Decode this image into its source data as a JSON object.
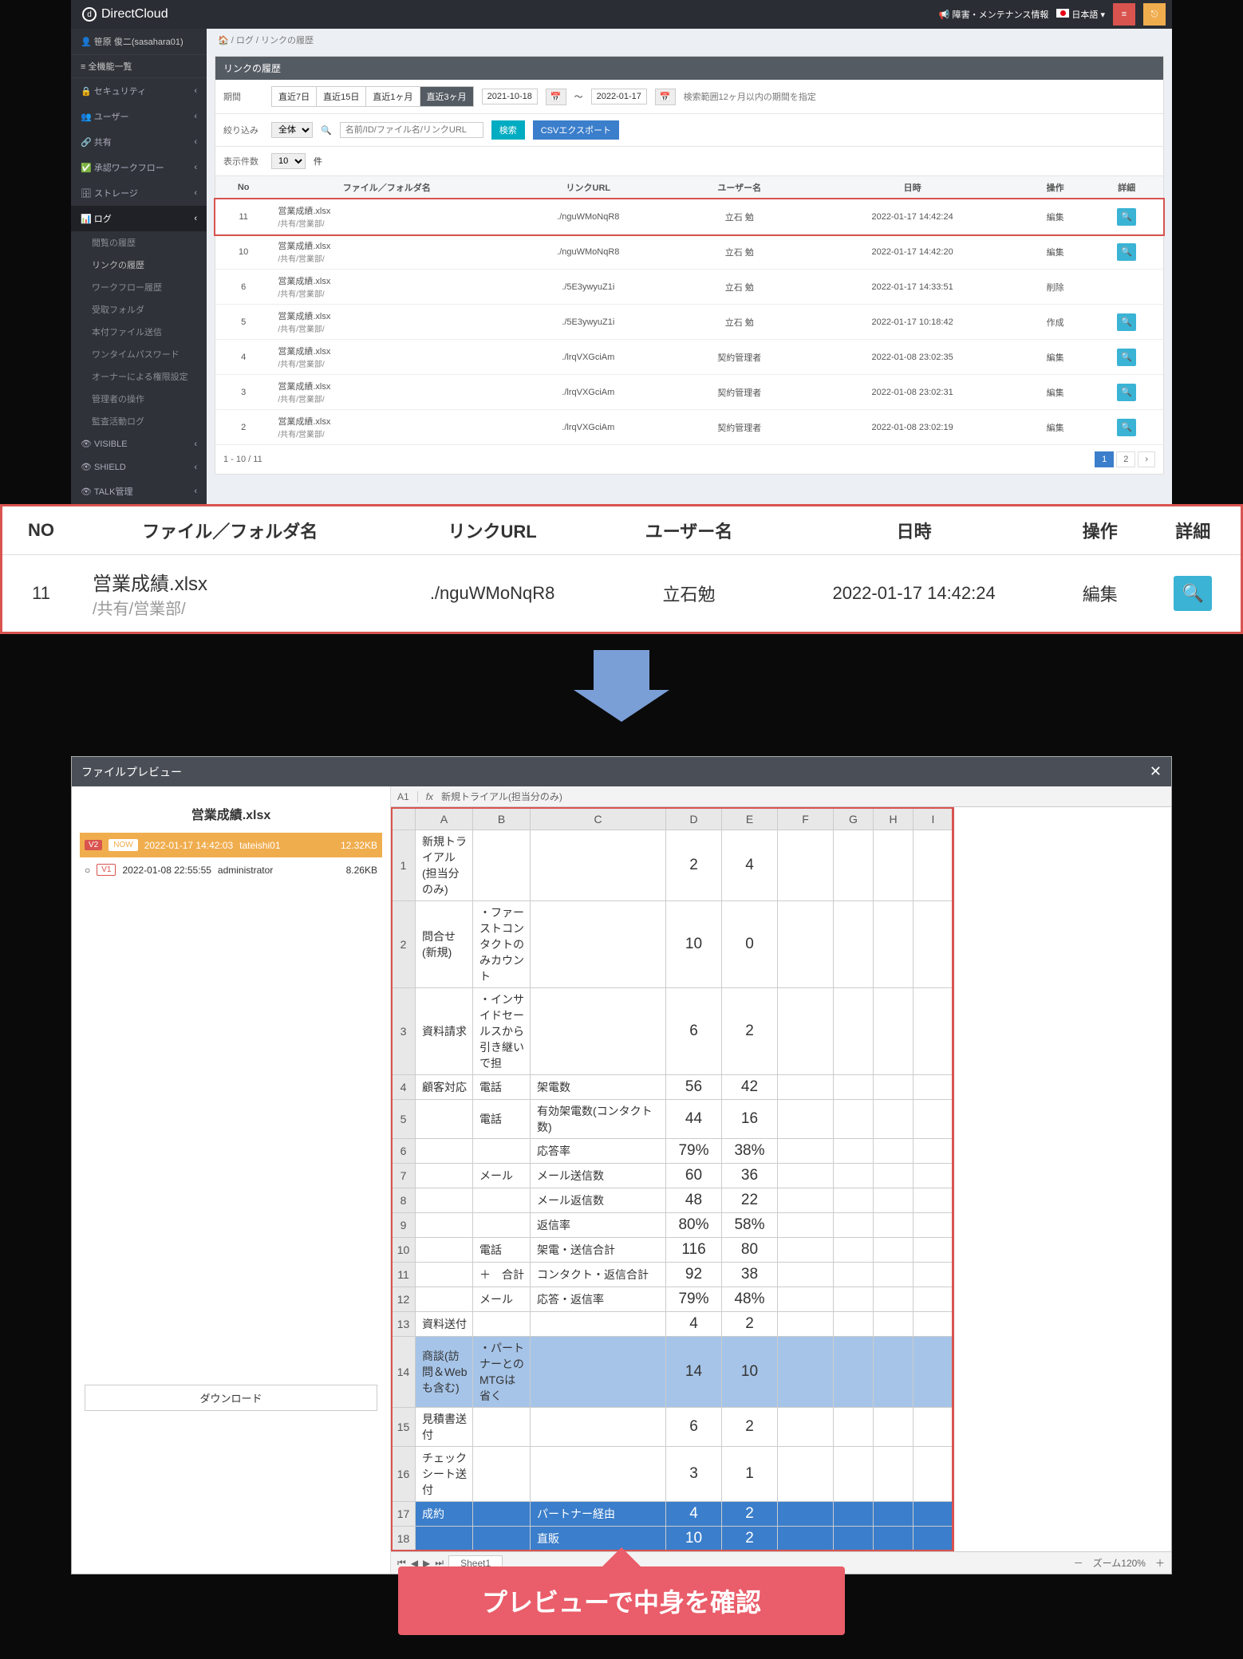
{
  "header": {
    "brand": "DirectCloud",
    "notice": "障害・メンテナンス情報",
    "lang": "日本語"
  },
  "sidebar": {
    "user": "笹原 俊二(sasahara01)",
    "menu_all": "全機能一覧",
    "items": [
      "セキュリティ",
      "ユーザー",
      "共有",
      "承認ワークフロー",
      "ストレージ",
      "ログ"
    ],
    "log_subs": [
      "閲覧の履歴",
      "リンクの履歴",
      "ワークフロー履歴",
      "受取フォルダ",
      "本付ファイル送信",
      "ワンタイムパスワード",
      "オーナーによる権限設定",
      "管理者の操作",
      "監査活動ログ"
    ],
    "extra": [
      "VISIBLE",
      "SHIELD",
      "TALK管理"
    ]
  },
  "crumb": {
    "home": "ログ",
    "leaf": "リンクの履歴"
  },
  "panel_title": "リンクの履歴",
  "filter": {
    "lbl_period": "期間",
    "segs": [
      "直近7日",
      "直近15日",
      "直近1ヶ月",
      "直近3ヶ月"
    ],
    "date_from": "2021-10-18",
    "date_to": "2022-01-17",
    "note": "検索範囲12ヶ月以内の期間を指定",
    "lbl_narrow": "絞り込み",
    "sel": "全体",
    "placeholder": "名前/ID/ファイル名/リンクURL",
    "btn_search": "検索",
    "btn_csv": "CSVエクスポート",
    "lbl_count": "表示件数",
    "count": "10",
    "count_suffix": "件"
  },
  "table": {
    "cols": [
      "No",
      "ファイル／フォルダ名",
      "リンクURL",
      "ユーザー名",
      "日時",
      "操作",
      "詳細"
    ],
    "rows": [
      {
        "no": "11",
        "name": "営業成績.xlsx",
        "path": "/共有/営業部/",
        "url": "./nguWMoNqR8",
        "user": "立石 勉",
        "time": "2022-01-17 14:42:24",
        "op": "編集",
        "mag": true,
        "hl": true
      },
      {
        "no": "10",
        "name": "営業成績.xlsx",
        "path": "/共有/営業部/",
        "url": "./nguWMoNqR8",
        "user": "立石 勉",
        "time": "2022-01-17 14:42:20",
        "op": "編集",
        "mag": true
      },
      {
        "no": "6",
        "name": "営業成績.xlsx",
        "path": "/共有/営業部/",
        "url": "./5E3ywyuZ1i",
        "user": "立石 勉",
        "time": "2022-01-17 14:33:51",
        "op": "削除",
        "mag": false
      },
      {
        "no": "5",
        "name": "営業成績.xlsx",
        "path": "/共有/営業部/",
        "url": "./5E3ywyuZ1i",
        "user": "立石 勉",
        "time": "2022-01-17 10:18:42",
        "op": "作成",
        "mag": true
      },
      {
        "no": "4",
        "name": "営業成績.xlsx",
        "path": "/共有/営業部/",
        "url": "./lrqVXGciAm",
        "user": "契約管理者",
        "time": "2022-01-08 23:02:35",
        "op": "編集",
        "mag": true
      },
      {
        "no": "3",
        "name": "営業成績.xlsx",
        "path": "/共有/営業部/",
        "url": "./lrqVXGciAm",
        "user": "契約管理者",
        "time": "2022-01-08 23:02:31",
        "op": "編集",
        "mag": true
      },
      {
        "no": "2",
        "name": "営業成績.xlsx",
        "path": "/共有/営業部/",
        "url": "./lrqVXGciAm",
        "user": "契約管理者",
        "time": "2022-01-08 23:02:19",
        "op": "編集",
        "mag": true
      }
    ],
    "pager_info": "1 - 10 / 11",
    "pages": [
      "1",
      "2",
      "›"
    ]
  },
  "big": {
    "cols": [
      "NO",
      "ファイル／フォルダ名",
      "リンクURL",
      "ユーザー名",
      "日時",
      "操作",
      "詳細"
    ],
    "no": "11",
    "name": "営業成績.xlsx",
    "path": "/共有/営業部/",
    "url": "./nguWMoNqR8",
    "user": "立石勉",
    "time": "2022-01-17 14:42:24",
    "op": "編集"
  },
  "preview": {
    "title": "ファイルプレビュー",
    "file": "営業成績.xlsx",
    "versions": [
      {
        "v": "V2",
        "now": "NOW",
        "time": "2022-01-17 14:42:03",
        "user": "tateishi01",
        "size": "12.32KB",
        "active": true
      },
      {
        "v": "V1",
        "now": "",
        "time": "2022-01-08 22:55:55",
        "user": "administrator",
        "size": "8.26KB",
        "active": false
      }
    ],
    "download": "ダウンロード",
    "cell_ref": "A1",
    "fx_val": "新規トライアル(担当分のみ)",
    "cols": [
      "",
      "A",
      "B",
      "C",
      "D",
      "E",
      "F",
      "G",
      "H",
      "I"
    ],
    "sheet_tab": "Sheet1",
    "zoom": "ズーム120%"
  },
  "chart_data": {
    "type": "table",
    "title": "営業成績",
    "columns": [
      "A",
      "B",
      "C",
      "D",
      "E"
    ],
    "rows": [
      {
        "r": 1,
        "A": "新規トライアル(担当分のみ)",
        "D": 2,
        "E": 4
      },
      {
        "r": 2,
        "A": "問合せ(新規)",
        "B": "・ファーストコンタクトのみカウント",
        "D": 10,
        "E": 0
      },
      {
        "r": 3,
        "A": "資料請求",
        "B": "・インサイドセールスから引き継いで担",
        "D": 6,
        "E": 2
      },
      {
        "r": 4,
        "A": "顧客対応",
        "B": "電話",
        "C": "架電数",
        "D": 56,
        "E": 42
      },
      {
        "r": 5,
        "B": "電話",
        "C": "有効架電数(コンタクト数)",
        "D": 44,
        "E": 16
      },
      {
        "r": 6,
        "C": "応答率",
        "D": "79%",
        "E": "38%"
      },
      {
        "r": 7,
        "B": "メール",
        "C": "メール送信数",
        "D": 60,
        "E": 36
      },
      {
        "r": 8,
        "C": "メール返信数",
        "D": 48,
        "E": 22
      },
      {
        "r": 9,
        "C": "返信率",
        "D": "80%",
        "E": "58%"
      },
      {
        "r": 10,
        "B": "電話",
        "C": "架電・送信合計",
        "D": 116,
        "E": 80
      },
      {
        "r": 11,
        "B": "＋　合計",
        "C": "コンタクト・返信合計",
        "D": 92,
        "E": 38
      },
      {
        "r": 12,
        "B": "メール",
        "C": "応答・返信率",
        "D": "79%",
        "E": "48%"
      },
      {
        "r": 13,
        "A": "資料送付",
        "D": 4,
        "E": 2
      },
      {
        "r": 14,
        "A": "商談(訪問＆Webも含む)",
        "B": "・パートナーとのMTGは省く",
        "D": 14,
        "E": 10,
        "cls": "blue"
      },
      {
        "r": 15,
        "A": "見積書送付",
        "D": 6,
        "E": 2
      },
      {
        "r": 16,
        "A": "チェックシート送付",
        "D": 3,
        "E": 1
      },
      {
        "r": 17,
        "A": "成約",
        "C": "パートナー経由",
        "D": 4,
        "E": 2,
        "cls": "dblue"
      },
      {
        "r": 18,
        "C": "直販",
        "D": 10,
        "E": 2,
        "cls": "dblue"
      }
    ]
  },
  "callout": "プレビューで中身を確認"
}
